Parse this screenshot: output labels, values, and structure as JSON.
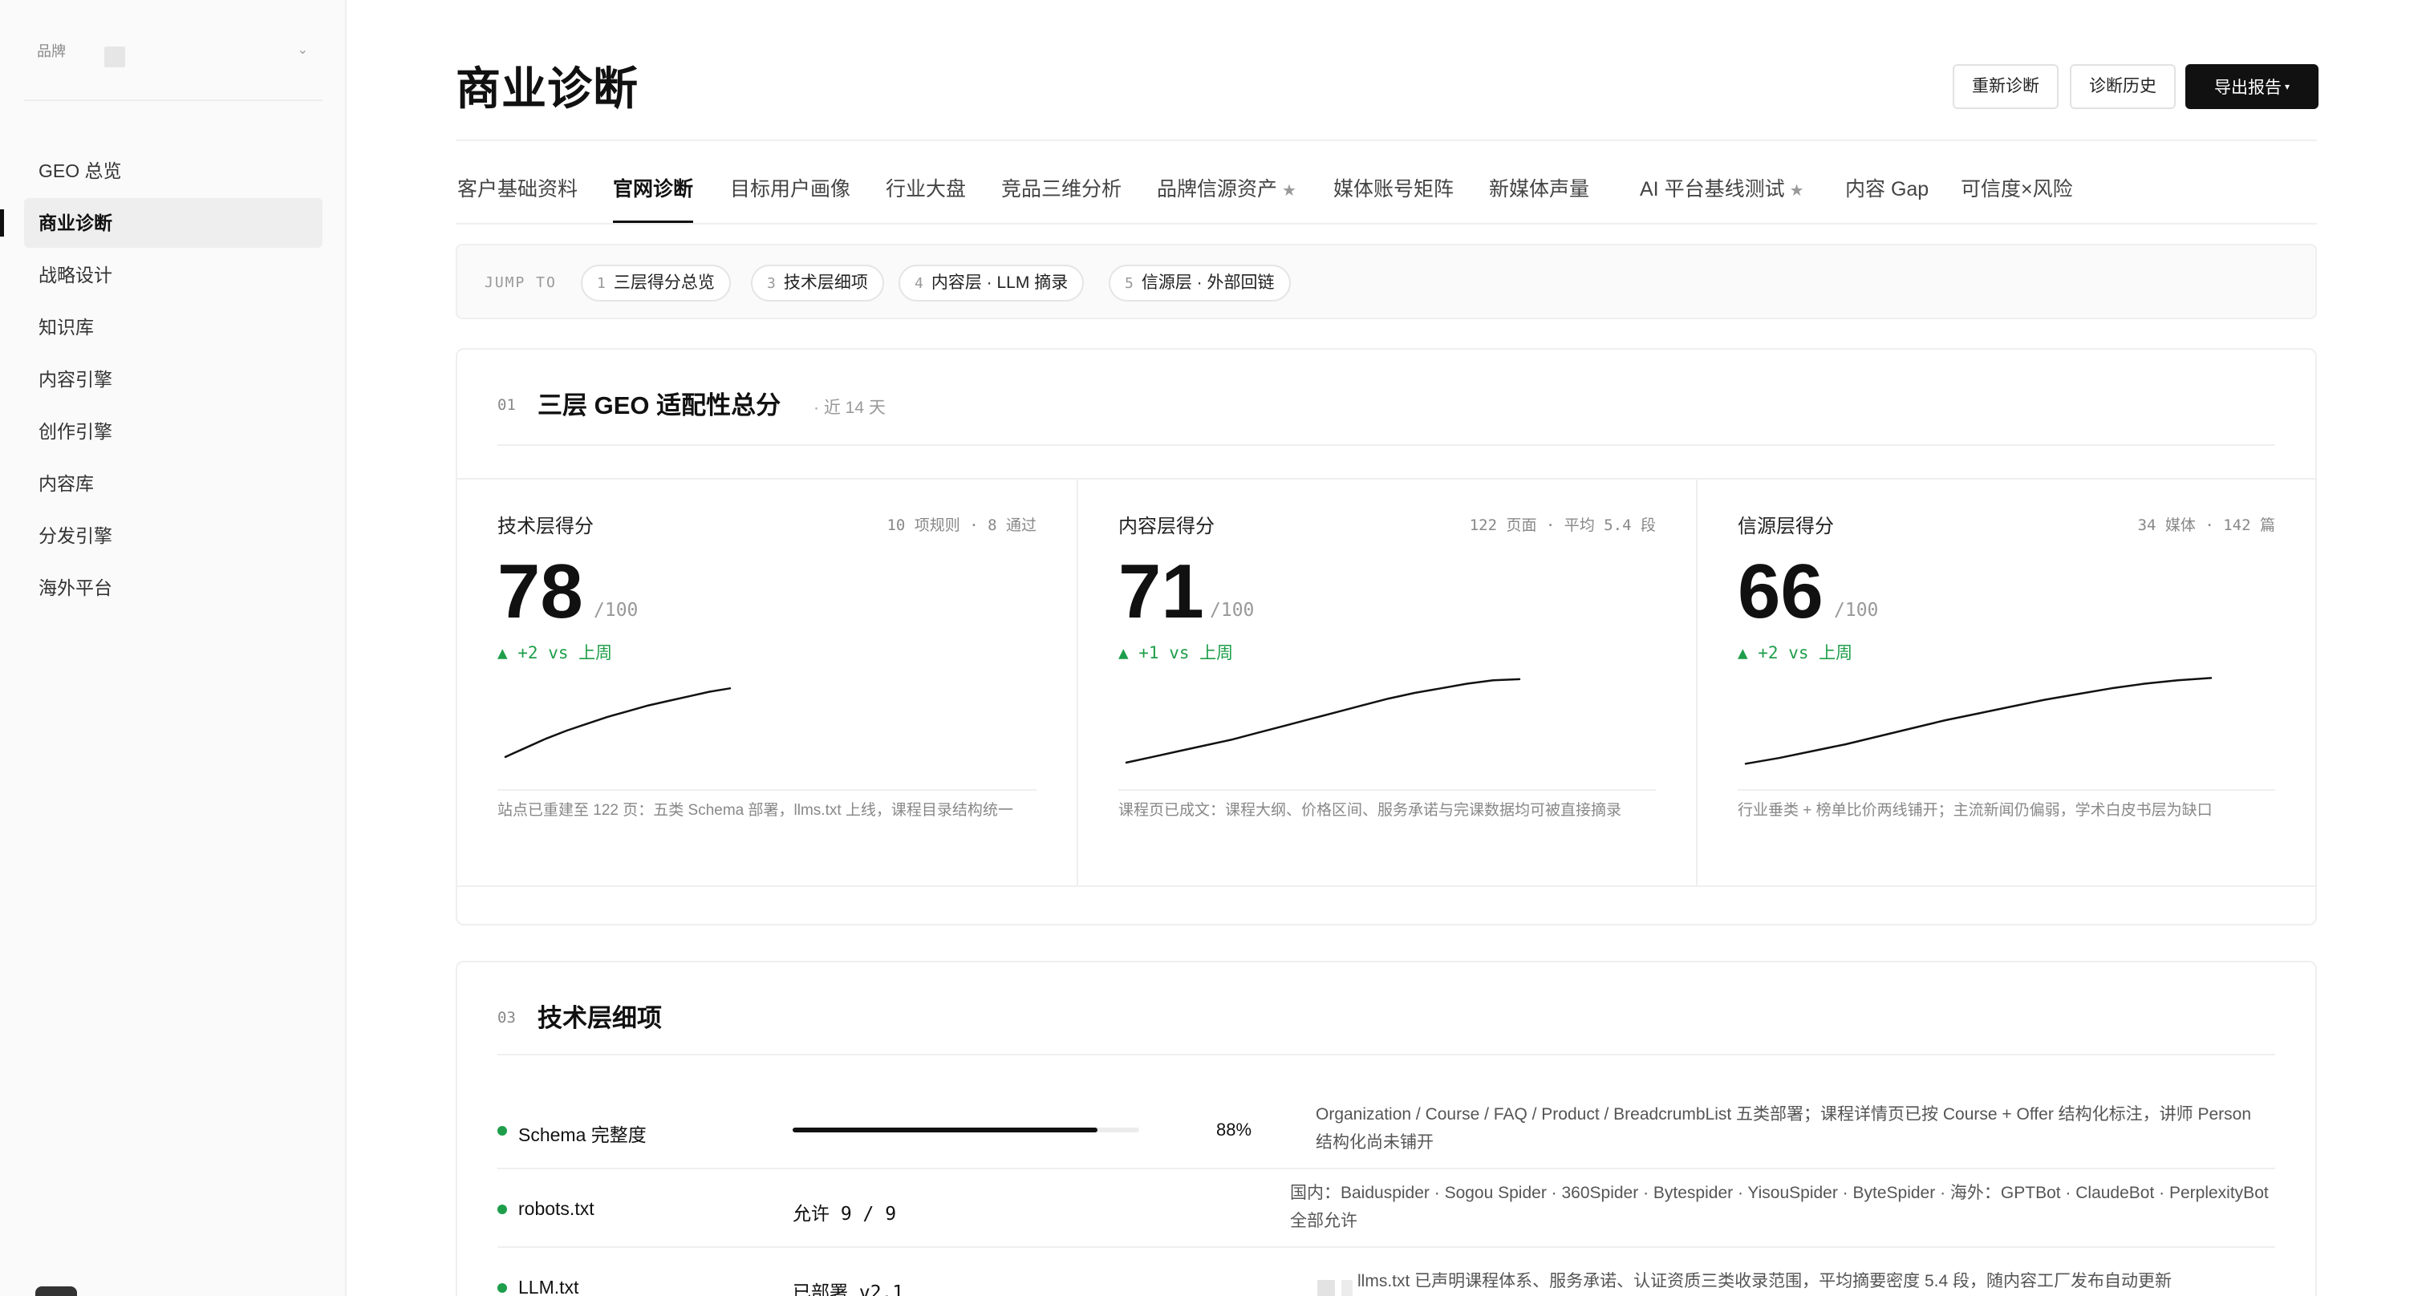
{
  "sidebar": {
    "brand_label": "品牌",
    "chevron": "⌄",
    "items": [
      {
        "label": "GEO 总览"
      },
      {
        "label": "商业诊断"
      },
      {
        "label": "战略设计"
      },
      {
        "label": "知识库"
      },
      {
        "label": "内容引擎"
      },
      {
        "label": "创作引擎"
      },
      {
        "label": "内容库"
      },
      {
        "label": "分发引擎"
      },
      {
        "label": "海外平台"
      }
    ],
    "active_index": 1
  },
  "header": {
    "title": "商业诊断",
    "buttons": {
      "rediagnose": "重新诊断",
      "history": "诊断历史",
      "export": "导出报告"
    }
  },
  "tabs": [
    {
      "label": "客户基础资料"
    },
    {
      "label": "官网诊断"
    },
    {
      "label": "目标用户画像"
    },
    {
      "label": "行业大盘"
    },
    {
      "label": "竞品三维分析"
    },
    {
      "label": "品牌信源资产",
      "star": "★"
    },
    {
      "label": "媒体账号矩阵"
    },
    {
      "label": "新媒体声量"
    },
    {
      "label": "AI 平台基线测试",
      "star": "★"
    },
    {
      "label": "内容 Gap"
    },
    {
      "label": "可信度×风险"
    }
  ],
  "active_tab": 1,
  "jump": {
    "label": "JUMP TO",
    "chips": [
      {
        "num": "1",
        "label": "三层得分总览"
      },
      {
        "num": "3",
        "label": "技术层细项"
      },
      {
        "num": "4",
        "label": "内容层 · LLM 摘录"
      },
      {
        "num": "5",
        "label": "信源层 · 外部回链"
      }
    ]
  },
  "overview": {
    "num": "01",
    "title": "三层 GEO 适配性总分",
    "subtitle": "· 近 14 天",
    "scores": [
      {
        "name": "技术层得分",
        "meta": "10 项规则 · 8 通过",
        "value": "78",
        "max": "/100",
        "delta": "▲ +2 vs 上周",
        "trend": [
          10,
          18,
          26,
          33,
          39,
          45,
          50,
          55,
          59,
          63,
          67,
          70
        ],
        "note": "站点已重建至 122 页：五类 Schema 部署，llms.txt 上线，课程目录结构统一"
      },
      {
        "name": "内容层得分",
        "meta": "122 页面 · 平均 5.4 段",
        "value": "71",
        "max": "/100",
        "delta": "▲ +1 vs 上周",
        "trend": [
          5,
          10,
          15,
          20,
          25,
          31,
          37,
          43,
          49,
          55,
          61,
          66,
          70,
          74,
          77,
          78
        ],
        "note": "课程页已成文：课程大纲、价格区间、服务承诺与完课数据均可被直接摘录"
      },
      {
        "name": "信源层得分",
        "meta": "34 媒体 · 142 篇",
        "value": "66",
        "max": "/100",
        "delta": "▲ +2 vs 上周",
        "trend": [
          4,
          9,
          15,
          21,
          28,
          35,
          42,
          48,
          54,
          60,
          65,
          70,
          74,
          77,
          79
        ],
        "note": "行业垂类 + 榜单比价两线铺开；主流新闻仍偏弱，学术白皮书层为缺口"
      }
    ]
  },
  "tech": {
    "num": "03",
    "title": "技术层细项",
    "rows": [
      {
        "name": "Schema 完整度",
        "progress": 0.88,
        "pct": "88%",
        "desc": "Organization / Course / FAQ / Product / BreadcrumbList 五类部署；课程详情页已按 Course + Offer 结构化标注，讲师 Person 结构化尚未铺开"
      },
      {
        "name": "robots.txt",
        "value": "允许 9 / 9",
        "desc": "国内：Baiduspider · Sogou Spider · 360Spider · Bytespider · YisouSpider · ByteSpider · 海外：GPTBot · ClaudeBot · PerplexityBot 全部允许"
      },
      {
        "name": "LLM.txt",
        "value": "已部署 v2.1",
        "desc": "llms.txt 已声明课程体系、服务承诺、认证资质三类收录范围，平均摘要密度 5.4 段，随内容工厂发布自动更新"
      }
    ]
  },
  "colors": {
    "accent": "#111111",
    "positive": "#1e9e4a",
    "border": "#efefef"
  }
}
